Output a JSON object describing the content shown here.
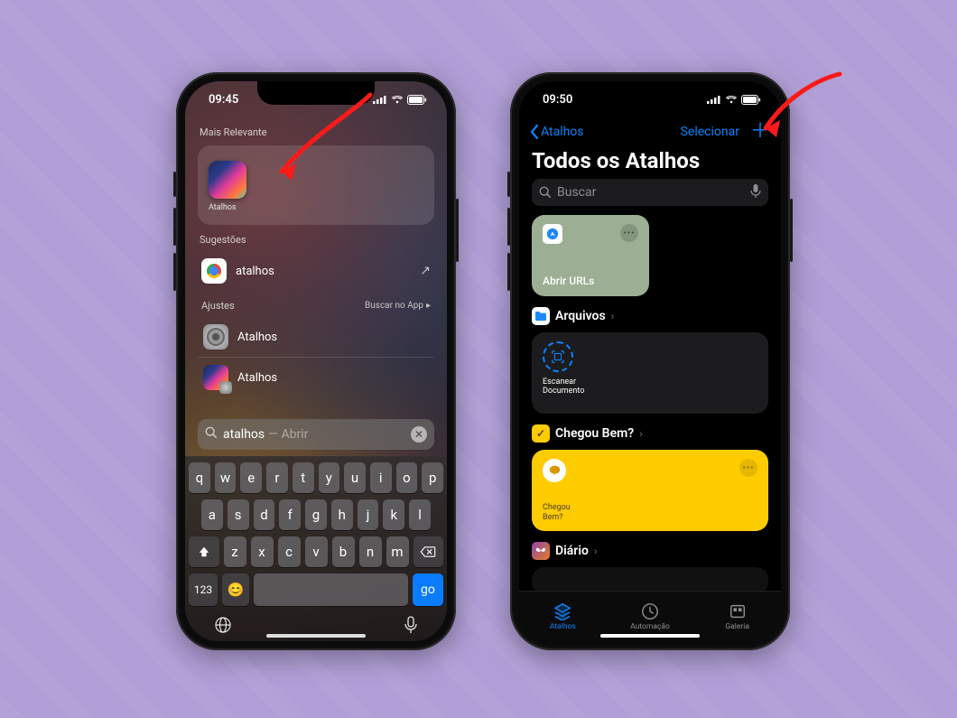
{
  "left": {
    "status_time": "09:45",
    "sections": {
      "top_hit_title": "Mais Relevante",
      "suggestions_title": "Sugestões",
      "settings_title": "Ajustes"
    },
    "top_hit": {
      "label": "Atalhos"
    },
    "suggestion": {
      "label": "atalhos"
    },
    "settings_action": "Buscar no App",
    "settings_items": [
      {
        "label": "Atalhos"
      },
      {
        "label": "Atalhos"
      }
    ],
    "search": {
      "query": "atalhos",
      "completion": "— Abrir"
    },
    "keyboard": {
      "row1": [
        "q",
        "w",
        "e",
        "r",
        "t",
        "y",
        "u",
        "i",
        "o",
        "p"
      ],
      "row2": [
        "a",
        "s",
        "d",
        "f",
        "g",
        "h",
        "j",
        "k",
        "l"
      ],
      "row3": [
        "z",
        "x",
        "c",
        "v",
        "b",
        "n",
        "m"
      ],
      "num_label": "123",
      "go_label": "go"
    }
  },
  "right": {
    "status_time": "09:50",
    "nav": {
      "back": "Atalhos",
      "select": "Selecionar"
    },
    "title": "Todos os Atalhos",
    "search_placeholder": "Buscar",
    "tile_open_urls": "Abrir URLs",
    "section_files": "Arquivos",
    "tile_scan": "Escanear Documento",
    "section_chegou": "Chegou Bem?",
    "tile_chegou": "Chegou Bem?",
    "section_diario": "Diário",
    "tabs": {
      "shortcuts": "Atalhos",
      "automation": "Automação",
      "gallery": "Galeria"
    }
  }
}
